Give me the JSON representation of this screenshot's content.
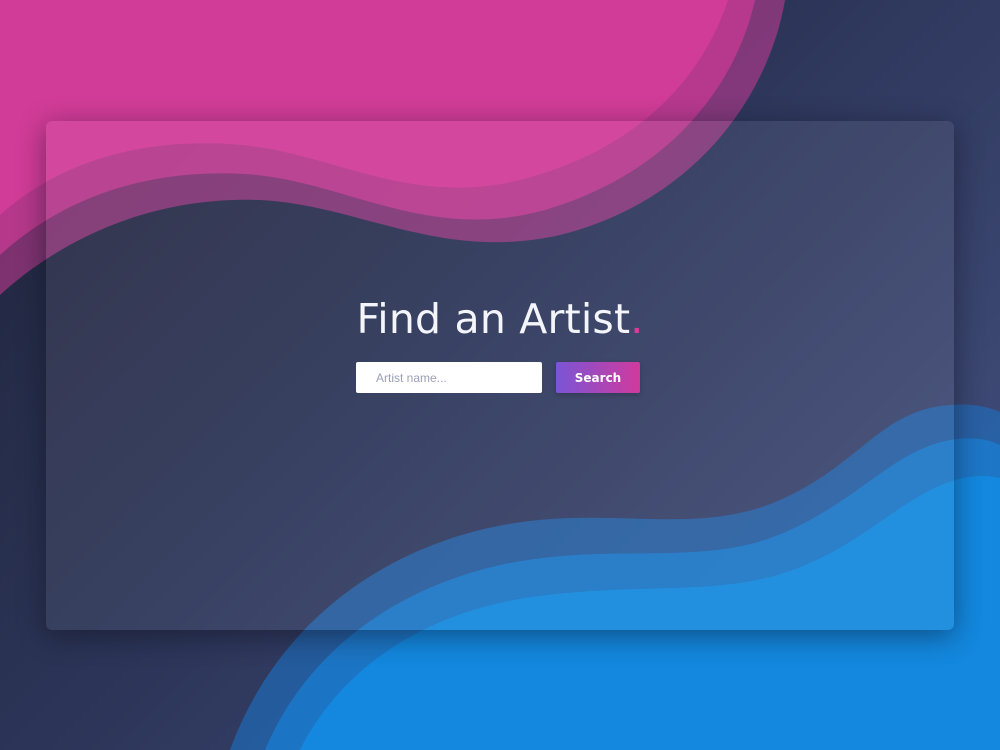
{
  "hero": {
    "title": "Find an Artist",
    "title_dot": "."
  },
  "search": {
    "placeholder": "Artist name...",
    "value": "",
    "button_label": "Search"
  },
  "colors": {
    "accent_pink": "#e0399c",
    "background_navy": "#2c3558",
    "wave_blue": "#1487dc",
    "button_gradient_start": "#7a55d6",
    "button_gradient_end": "#d03a9d"
  }
}
